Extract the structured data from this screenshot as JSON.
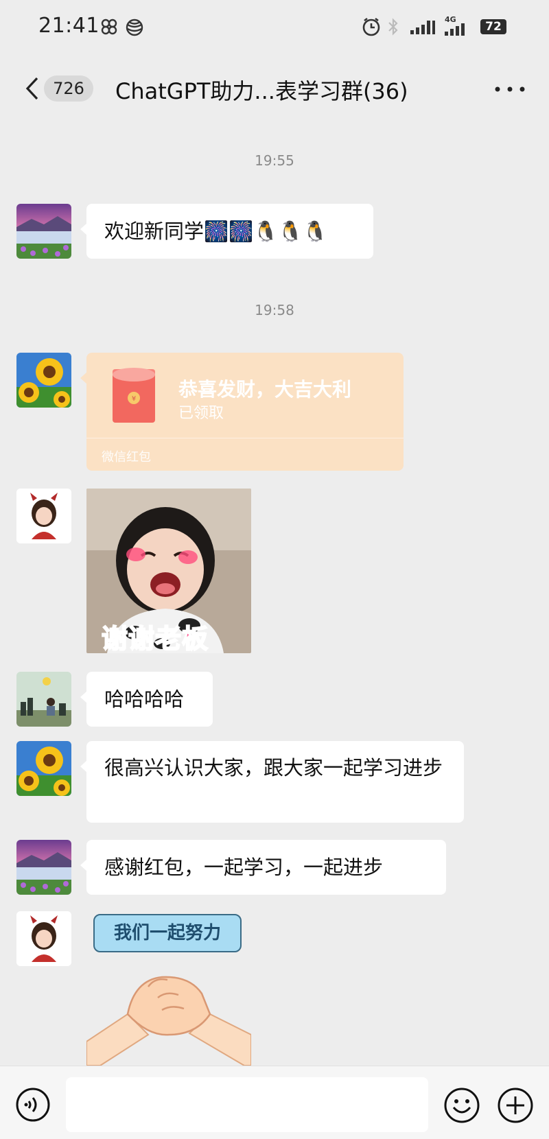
{
  "status_bar": {
    "time": "21:41",
    "battery": "72",
    "network": "4G"
  },
  "nav": {
    "unread_count": "726",
    "title": "ChatGPT助力...表学习群(36)"
  },
  "timestamps": [
    "19:55",
    "19:58"
  ],
  "messages": [
    {
      "type": "text",
      "text": "欢迎新同学🎆🎆🐧🐧🐧"
    },
    {
      "type": "red_packet",
      "title": "恭喜发财，大吉大利",
      "status": "已领取",
      "brand": "微信红包"
    },
    {
      "type": "sticker",
      "caption": "谢谢老板"
    },
    {
      "type": "text",
      "text": "哈哈哈哈"
    },
    {
      "type": "text",
      "text": "很高兴认识大家，跟大家一起学习进步"
    },
    {
      "type": "text",
      "text": "感谢红包，一起学习，一起进步"
    },
    {
      "type": "sticker",
      "caption": "我们一起努力"
    }
  ],
  "colors": {
    "bg": "#ededed",
    "bubble": "#ffffff",
    "red_packet": "#fbe1c4",
    "red_envelope": "#f2685f"
  }
}
